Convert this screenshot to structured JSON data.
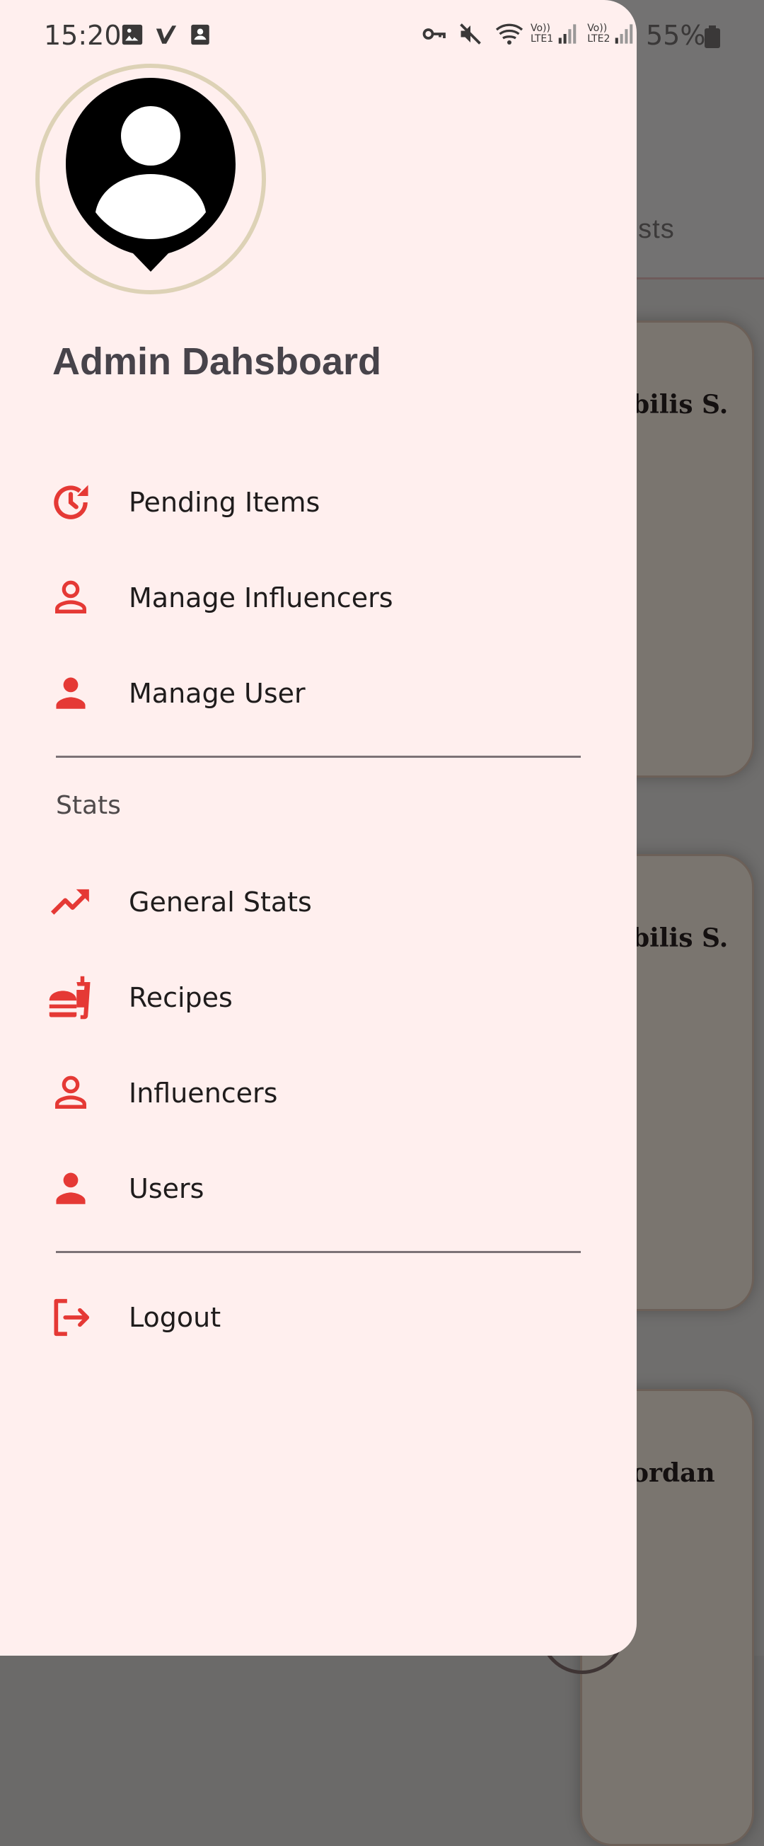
{
  "status_bar": {
    "time": "15:20",
    "battery_percent": "55%",
    "lte1_label": "LTE1",
    "lte2_label": "LTE2",
    "volte_label": "Vo))"
  },
  "background": {
    "tab_fragment": "ests",
    "cards": [
      {
        "name": "bilis S."
      },
      {
        "name": "bilis S."
      },
      {
        "name": "ordan"
      }
    ]
  },
  "drawer": {
    "title": "Admin Dahsboard",
    "items": [
      {
        "label": "Pending Items",
        "icon": "clock-refresh-icon"
      },
      {
        "label": "Manage Influencers",
        "icon": "person-outline-icon"
      },
      {
        "label": "Manage User",
        "icon": "person-icon"
      }
    ],
    "stats_section_label": "Stats",
    "stats_items": [
      {
        "label": "General Stats",
        "icon": "trending-up-icon"
      },
      {
        "label": "Recipes",
        "icon": "fastfood-icon"
      },
      {
        "label": "Influencers",
        "icon": "person-outline-icon"
      },
      {
        "label": "Users",
        "icon": "person-icon"
      }
    ],
    "logout_label": "Logout",
    "accent_color": "#e53935"
  }
}
